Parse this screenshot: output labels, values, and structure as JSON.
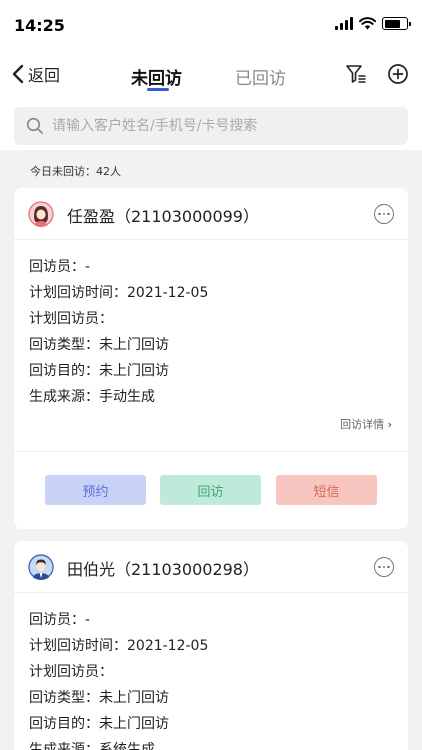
{
  "status_bar": {
    "time": "14:25"
  },
  "nav": {
    "back_label": "返回",
    "tabs": [
      {
        "label": "未回访",
        "active": true
      },
      {
        "label": "已回访",
        "active": false
      }
    ]
  },
  "search": {
    "placeholder": "请输入客户姓名/手机号/卡号搜索"
  },
  "summary": {
    "count_text": "今日未回访：42人"
  },
  "cards": [
    {
      "title": "任盈盈（21103000099）",
      "avatar": "female-avatar",
      "fields": [
        "回访员：-",
        "计划回访时间：2021-12-05",
        "计划回访员：",
        "回访类型：未上门回访",
        "回访目的：未上门回访",
        "生成来源：手动生成"
      ],
      "detail_link": "回访详情",
      "actions": [
        "预约",
        "回访",
        "短信"
      ]
    },
    {
      "title": "田伯光（21103000298）",
      "avatar": "male-avatar",
      "fields": [
        "回访员：-",
        "计划回访时间：2021-12-05",
        "计划回访员：",
        "回访类型：未上门回访",
        "回访目的：未上门回访",
        "生成来源：系统生成"
      ]
    }
  ],
  "colors": {
    "accent": "#3a5bd9",
    "btn_book_bg": "#c9d1f7",
    "btn_visit_bg": "#bfe9d9",
    "btn_sms_bg": "#f7c6c1"
  }
}
